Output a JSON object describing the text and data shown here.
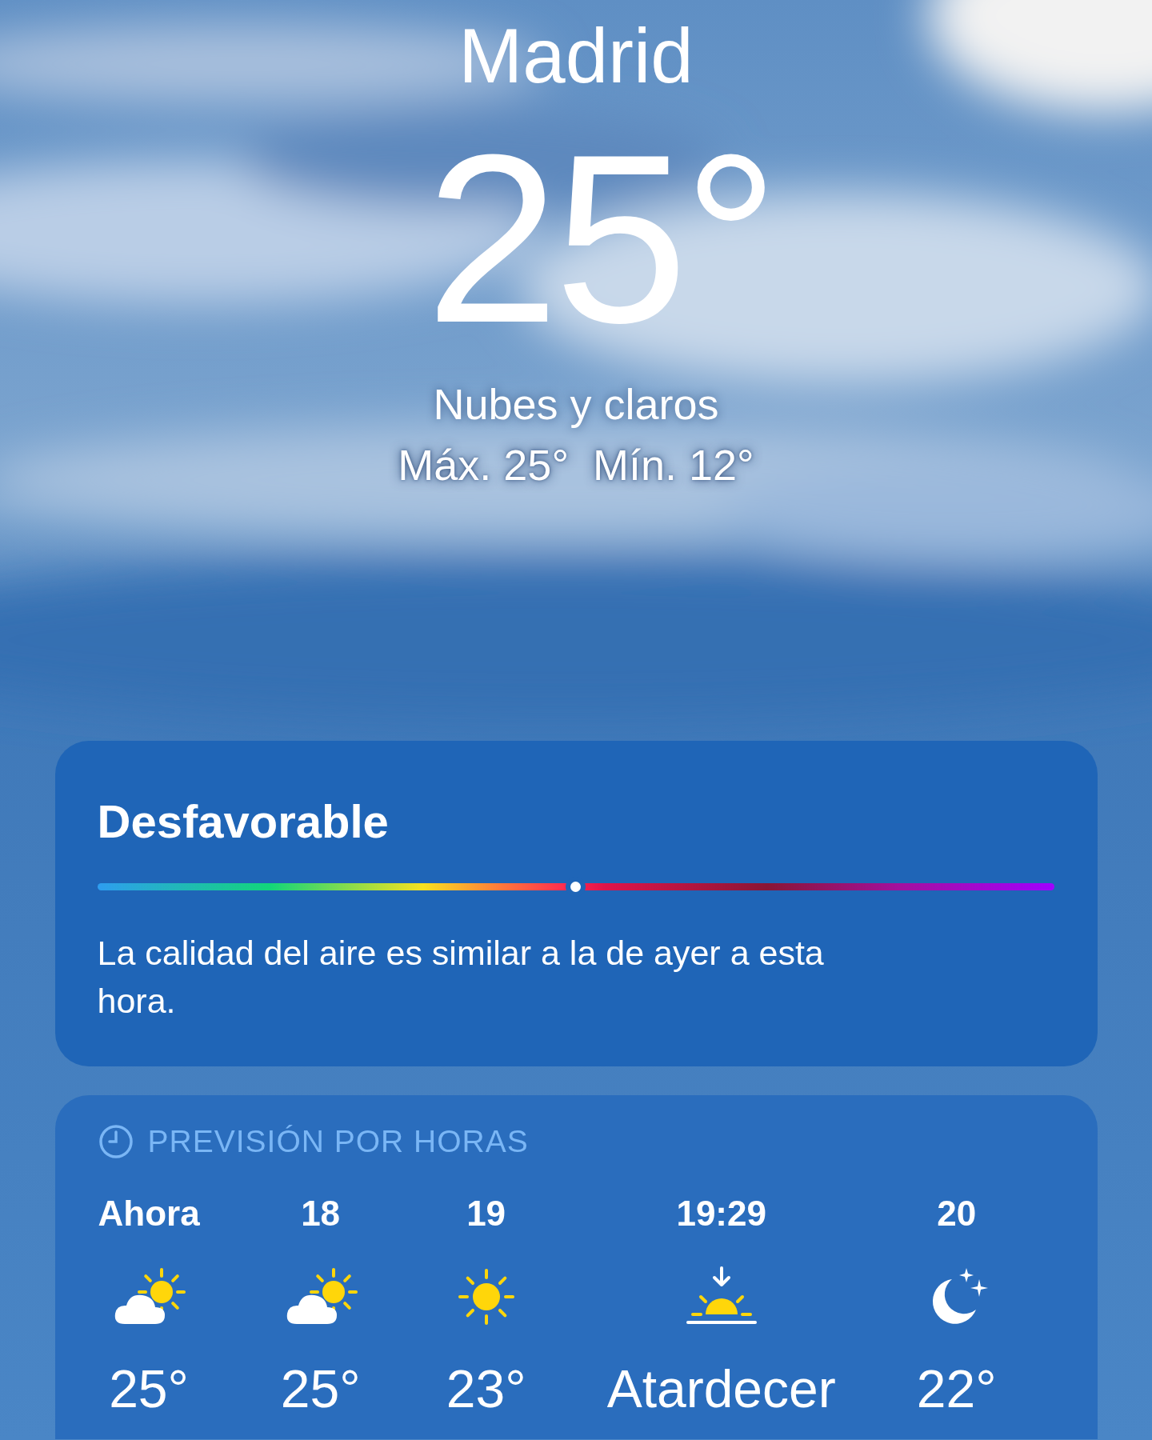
{
  "location": {
    "city": "Madrid",
    "temperature": "25°",
    "condition": "Nubes y claros",
    "high_low": "Máx. 25°  Mín. 12°"
  },
  "air_quality": {
    "category": "Desfavorable",
    "level": 0.5,
    "description": "La calidad del aire es similar a la de ayer a esta hora."
  },
  "hourly_forecast": {
    "title": "PREVISIÓN POR HORAS",
    "hours": [
      {
        "time": "Ahora",
        "kind": "partly_cloudy",
        "value": "25°"
      },
      {
        "time": "18",
        "kind": "partly_cloudy",
        "value": "25°"
      },
      {
        "time": "19",
        "kind": "sunny",
        "value": "23°"
      },
      {
        "time": "19:29",
        "kind": "sunset",
        "value": "Atardecer"
      },
      {
        "time": "20",
        "kind": "clear_night",
        "value": "22°"
      }
    ]
  }
}
